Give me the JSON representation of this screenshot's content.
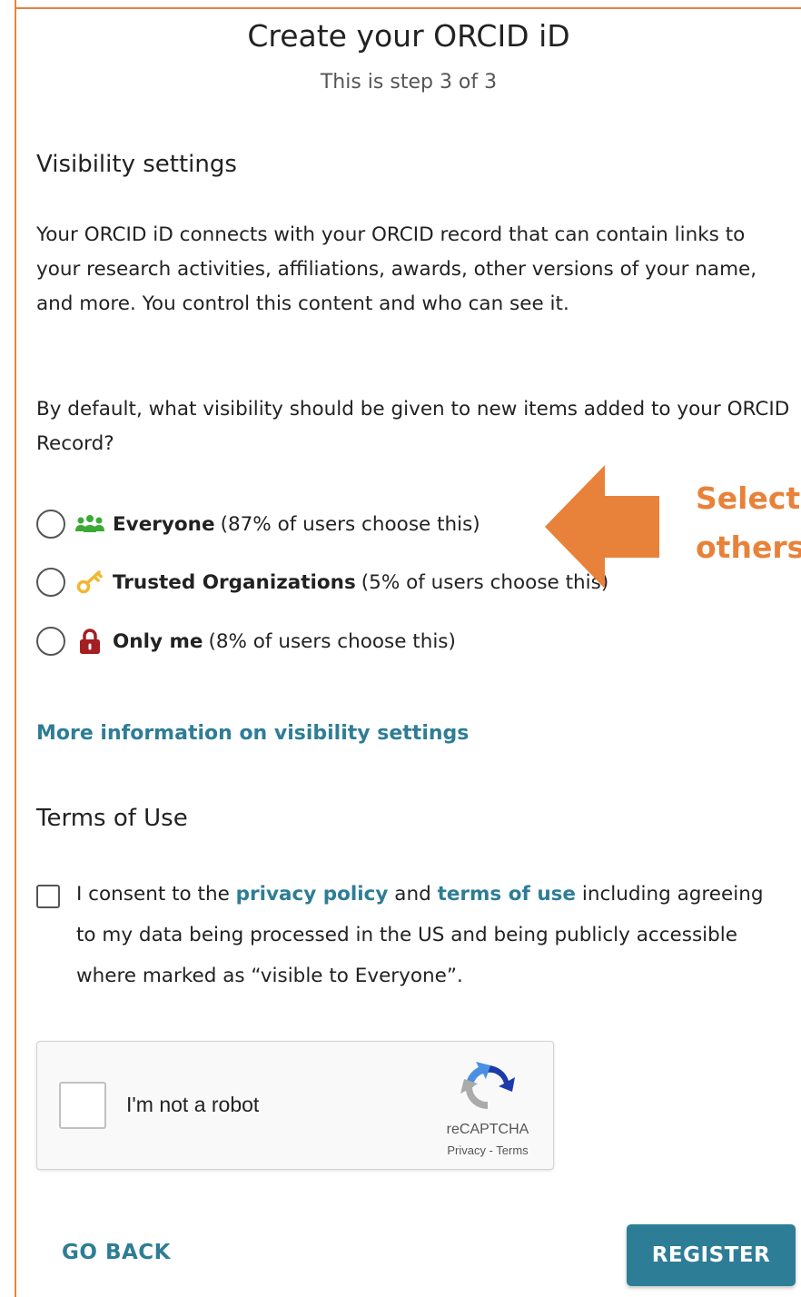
{
  "header": {
    "title": "Create your ORCID iD",
    "step": "This is step 3 of 3"
  },
  "visibility": {
    "heading": "Visibility settings",
    "intro": "Your ORCID iD connects with your ORCID record that can contain links to your research activities, affiliations, awards, other versions of your name, and more. You control this content and who can see it.",
    "question": "By default, what visibility should be given to new items added to your ORCID Record?",
    "options": [
      {
        "label": "Everyone",
        "note": "(87% of users choose this)",
        "icon": "people-icon",
        "color": "#3aaa35"
      },
      {
        "label": "Trusted Organizations",
        "note": "(5% of users choose this)",
        "icon": "key-icon",
        "color": "#f2b632"
      },
      {
        "label": "Only me",
        "note": "(8% of users choose this)",
        "icon": "lock-icon",
        "color": "#a41e22"
      }
    ],
    "more_info_link": "More information on visibility settings"
  },
  "annotation": {
    "line1": "Select",
    "line2": "others",
    "color": "#e8823a"
  },
  "terms": {
    "heading": "Terms of Use",
    "consent_prefix": "I consent to the ",
    "privacy_link": "privacy policy",
    "and": " and ",
    "terms_link": "terms of use",
    "consent_suffix": " including agreeing to my data being processed in the US and being publicly accessible where marked as “visible to Everyone”."
  },
  "captcha": {
    "label": "I'm not a robot",
    "brand": "reCAPTCHA",
    "links": "Privacy - Terms"
  },
  "actions": {
    "back": "GO BACK",
    "register": "REGISTER",
    "accent": "#2e7d96"
  }
}
